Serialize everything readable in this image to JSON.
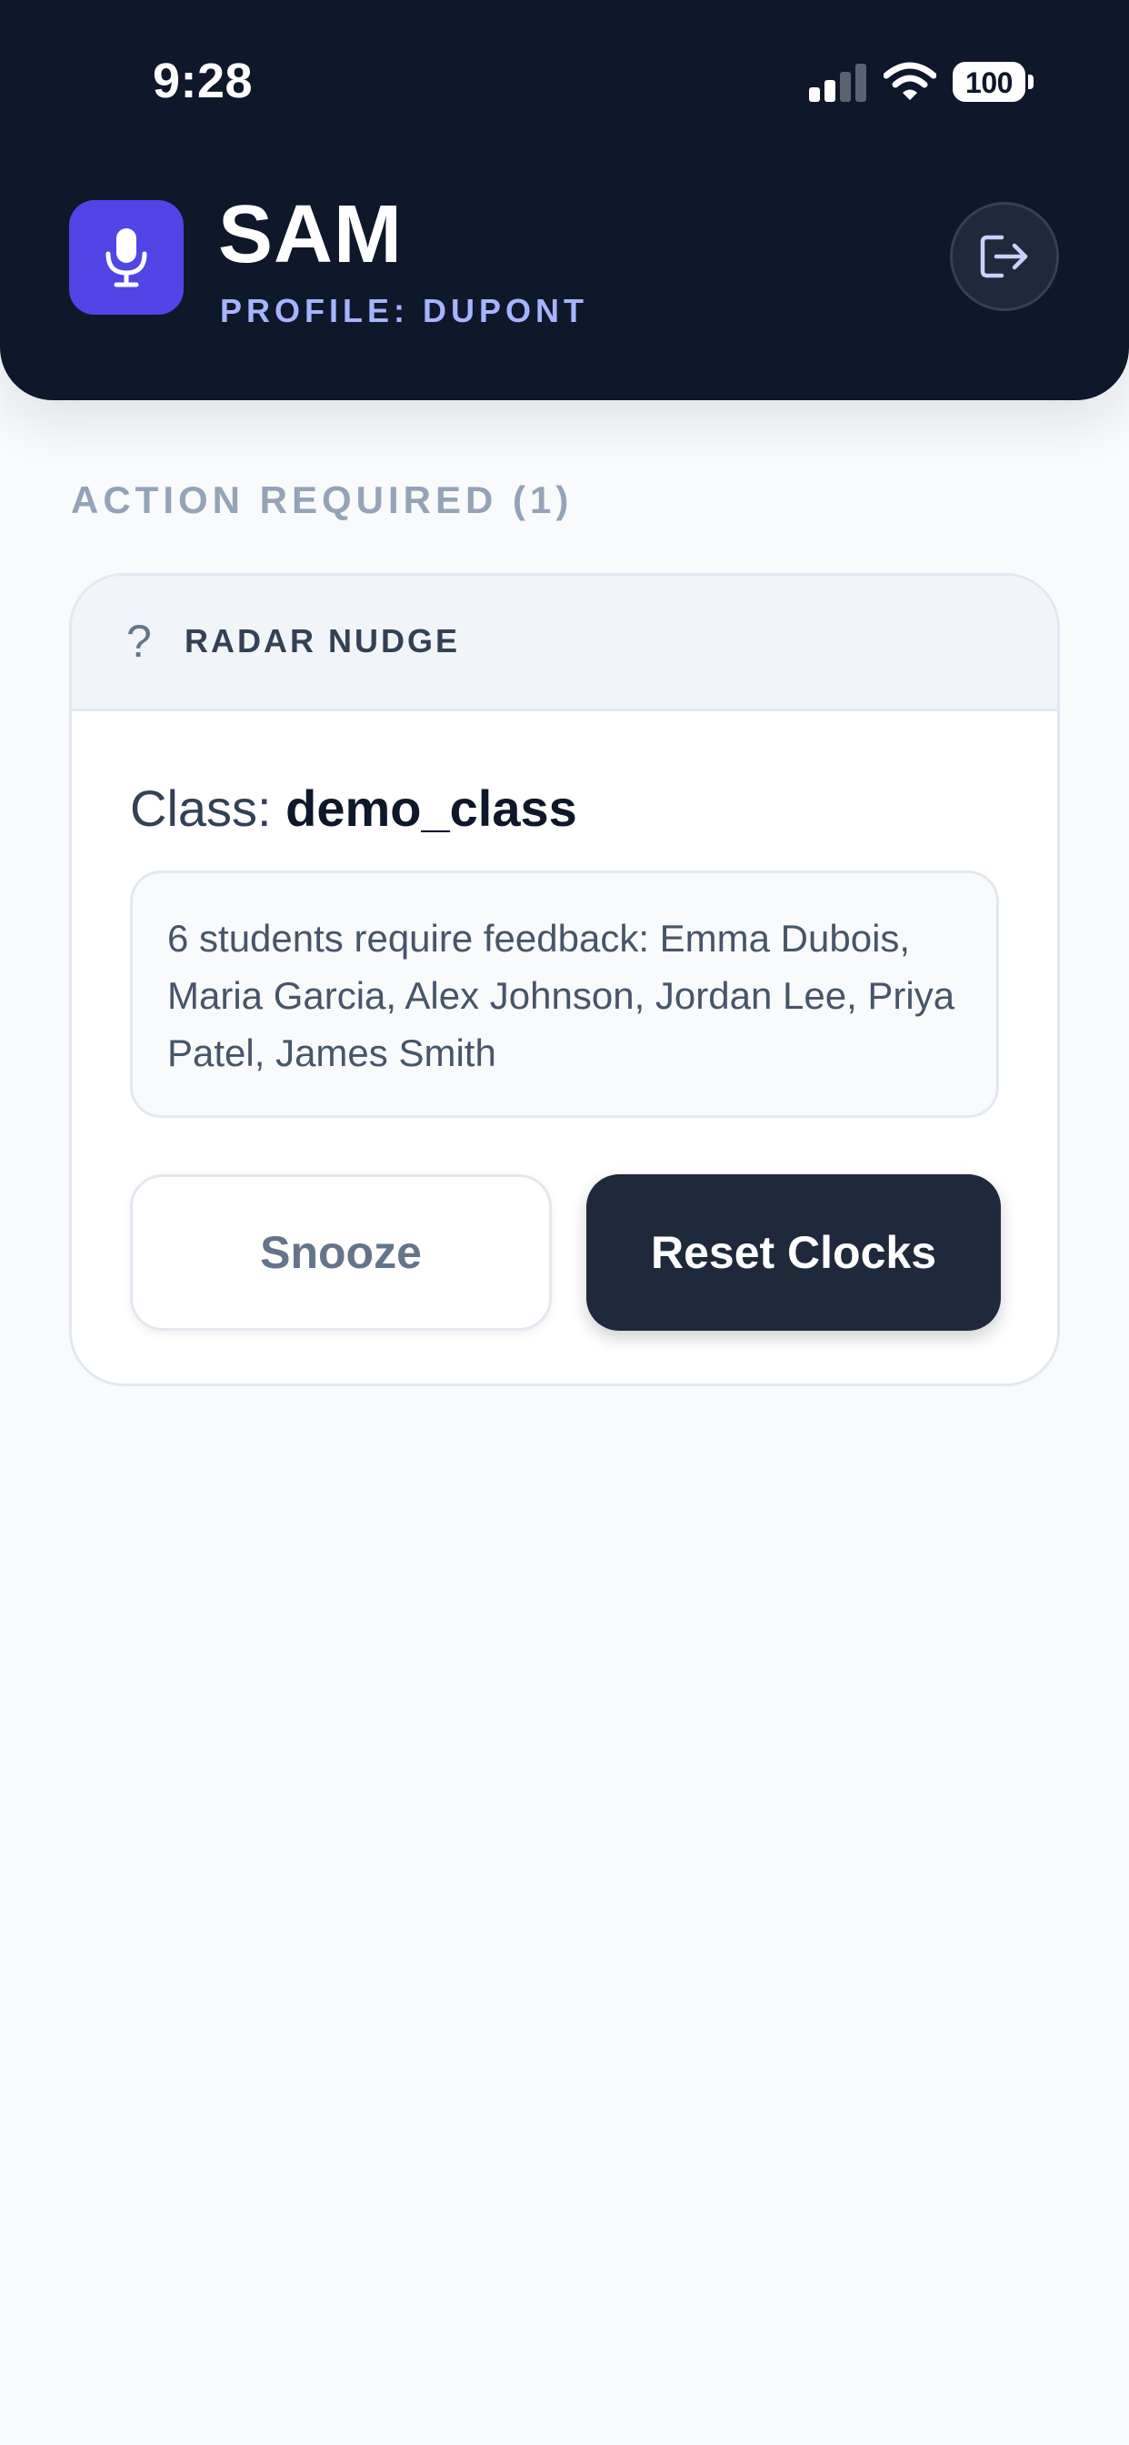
{
  "status_bar": {
    "time": "9:28",
    "battery_percent": 100,
    "battery_label": "100",
    "icons": [
      "cellular-signal-icon",
      "wifi-icon",
      "battery-icon"
    ]
  },
  "header": {
    "app_name": "SAM",
    "profile_label": "PROFILE: DUPONT",
    "app_icon": "microphone-icon",
    "logout_icon": "logout-icon"
  },
  "section": {
    "heading": "ACTION REQUIRED (1)"
  },
  "card": {
    "type_icon": "question-icon",
    "type_label": "RADAR NUDGE",
    "class_prefix": "Class:",
    "class_name": "demo_class",
    "message": "6 students require feedback: Emma Dubois, Maria Garcia, Alex Johnson, Jordan Lee, Priya Patel, James Smith",
    "snooze_label": "Snooze",
    "reset_label": "Reset Clocks"
  },
  "colors": {
    "header_bg": "#0f172a",
    "accent": "#4f46e5",
    "subtitle": "#a5b4fc",
    "primary_button": "#1e293b",
    "page_bg": "#f8fafc"
  }
}
